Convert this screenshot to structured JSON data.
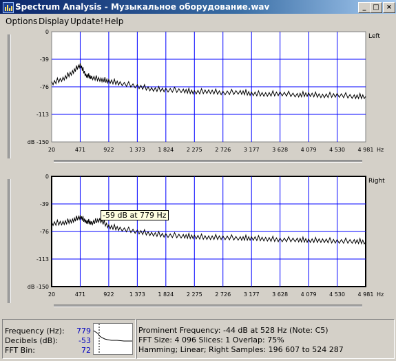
{
  "window": {
    "title": "Spectrum Analysis - Музыкальное оборудование.wav",
    "controls": [
      "_",
      "□",
      "×"
    ]
  },
  "menu": [
    "Options",
    "Display",
    "Update!",
    "Help"
  ],
  "charts": [
    {
      "channel": "Left",
      "ylabels": [
        "0",
        "-39",
        "-76",
        "-113",
        "dB -150"
      ],
      "xlabels": [
        "20",
        "471",
        "922",
        "1 373",
        "1 824",
        "2 275",
        "2 726",
        "3 177",
        "3 628",
        "4 079",
        "4 530",
        "4 981"
      ],
      "x_unit": "Hz"
    },
    {
      "channel": "Right",
      "ylabels": [
        "0",
        "-39",
        "-76",
        "-113",
        "dB -150"
      ],
      "xlabels": [
        "20",
        "471",
        "922",
        "1 373",
        "1 824",
        "2 275",
        "2 726",
        "3 177",
        "3 628",
        "4 079",
        "4 530",
        "4 981"
      ],
      "x_unit": "Hz",
      "tooltip": "-59 dB at 779 Hz"
    }
  ],
  "chart_data": [
    {
      "type": "line",
      "series": [
        {
          "name": "Left",
          "x": [
            20,
            200,
            350,
            471,
            560,
            650,
            800,
            922,
            1100,
            1373,
            1600,
            1824,
            2100,
            2275,
            2500,
            2726,
            3000,
            3177,
            3400,
            3628,
            3900,
            4079,
            4300,
            4530,
            4800,
            4981
          ],
          "y": [
            -70,
            -64,
            -55,
            -45,
            -59,
            -62,
            -65,
            -67,
            -70,
            -74,
            -78,
            -79,
            -80,
            -82,
            -81,
            -83,
            -82,
            -84,
            -85,
            -84,
            -86,
            -85,
            -87,
            -86,
            -88,
            -88
          ]
        }
      ],
      "xlim": [
        20,
        4981
      ],
      "ylim": [
        -150,
        0
      ],
      "grid": true
    },
    {
      "type": "line",
      "series": [
        {
          "name": "Right",
          "x": [
            20,
            200,
            350,
            471,
            560,
            650,
            779,
            922,
            1100,
            1373,
            1600,
            1824,
            2100,
            2275,
            2500,
            2726,
            3000,
            3177,
            3400,
            3628,
            3900,
            4079,
            4300,
            4530,
            4800,
            4981
          ],
          "y": [
            -64,
            -63,
            -60,
            -55,
            -61,
            -63,
            -59,
            -68,
            -71,
            -75,
            -78,
            -80,
            -81,
            -82,
            -83,
            -83,
            -84,
            -84,
            -85,
            -86,
            -86,
            -87,
            -87,
            -88,
            -88,
            -89
          ]
        }
      ],
      "xlim": [
        20,
        4981
      ],
      "ylim": [
        -150,
        0
      ],
      "grid": true
    }
  ],
  "status": {
    "frequency_label": "Frequency (Hz):",
    "frequency_value": "779",
    "decibels_label": "Decibels (dB):",
    "decibels_value": "-53",
    "fftbin_label": "FFT Bin:",
    "fftbin_value": "72",
    "line1": "Prominent Frequency: -44 dB at 528 Hz (Note: C5)",
    "line2": "FFT Size: 4 096  Slices: 1  Overlap: 75%",
    "line3": "Hamming; Linear; Right  Samples: 196 607 to 524 287"
  },
  "colors": {
    "grid": "#0000ff",
    "plot_bg": "#ffffff",
    "value_text": "#0000c0"
  }
}
